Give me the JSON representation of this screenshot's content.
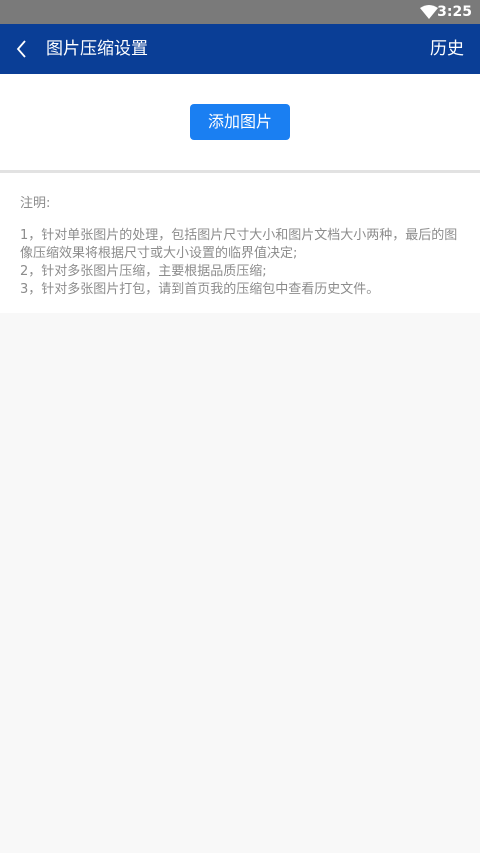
{
  "status_bar": {
    "time": "3:25",
    "wifi_icon": "wifi-icon"
  },
  "app_bar": {
    "back_icon": "back-chevron-icon",
    "title": "图片压缩设置",
    "history_label": "历史"
  },
  "actions": {
    "add_image_label": "添加图片"
  },
  "notes": {
    "heading": "注明:",
    "lines": [
      "1，针对单张图片的处理，包括图片尺寸大小和图片文档大小两种，最后的图像压缩效果将根据尺寸或大小设置的临界值决定;",
      "2，针对多张图片压缩，主要根据品质压缩;",
      "3，针对多张图片打包，请到首页我的压缩包中查看历史文件。"
    ]
  },
  "colors": {
    "app_bar": "#0a3e96",
    "button": "#1a7ff2",
    "status_bar": "#7a7a7a",
    "note_text": "#8c8c8c"
  }
}
